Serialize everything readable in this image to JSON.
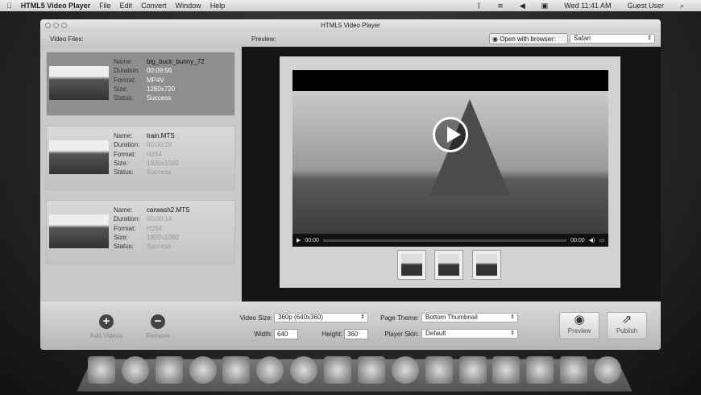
{
  "menubar": {
    "app": "HTML5 Video Player",
    "menus": [
      "File",
      "Edit",
      "Convert",
      "Window",
      "Help"
    ],
    "clock": "Wed 11:41 AM",
    "user": "Guest User"
  },
  "window": {
    "title": "HTML5 Video Player",
    "video_files_label": "Video Files:",
    "preview_label": "Preview:",
    "open_with_label": "Open with browser:",
    "browser": "Safari"
  },
  "field_labels": {
    "name": "Name:",
    "duration": "Duration:",
    "format": "Format:",
    "size": "Size:",
    "status": "Status:"
  },
  "videos": [
    {
      "name": "big_buck_bunny_72",
      "duration": "00:09:56",
      "format": "MP4V",
      "size": "1280x720",
      "status": "Success"
    },
    {
      "name": "train.MTS",
      "duration": "00:00:28",
      "format": "H264",
      "size": "1920x1080",
      "status": "Success"
    },
    {
      "name": "carwash2.MTS",
      "duration": "00:00:14",
      "format": "H264",
      "size": "1920x1080",
      "status": "Success"
    }
  ],
  "player": {
    "current_time": "00:00",
    "total_time": "00:00"
  },
  "bottom": {
    "add_label": "Add Videos",
    "remove_label": "Remove",
    "video_size_label": "Video Size:",
    "video_size": "360p (640x360)",
    "width_label": "Width:",
    "width": "640",
    "height_label": "Height:",
    "height": "360",
    "page_theme_label": "Page Theme:",
    "page_theme": "Bottom Thumbnail",
    "player_skin_label": "Player Skin:",
    "player_skin": "Default",
    "preview_btn": "Preview",
    "publish_btn": "Publish"
  }
}
